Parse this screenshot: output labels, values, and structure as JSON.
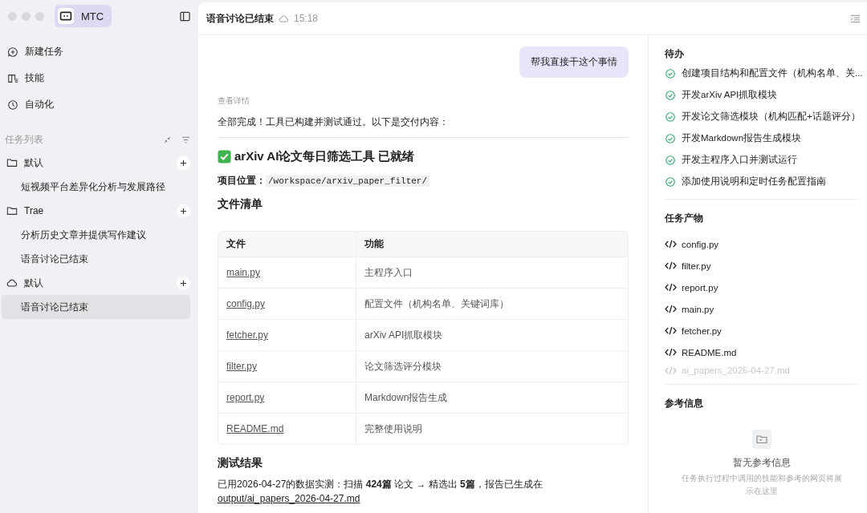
{
  "app": {
    "name": "MTC"
  },
  "nav": [
    {
      "label": "新建任务",
      "kind": "new"
    },
    {
      "label": "技能",
      "kind": "skills"
    },
    {
      "label": "自动化",
      "kind": "automation"
    }
  ],
  "task_list": {
    "title": "任务列表",
    "groups": [
      {
        "name": "默认",
        "kind": "folder",
        "items": [
          {
            "label": "短视频平台差异化分析与发展路径",
            "selected": false
          }
        ]
      },
      {
        "name": "Trae",
        "kind": "folder",
        "items": [
          {
            "label": "分析历史文章并提供写作建议",
            "selected": false
          },
          {
            "label": "语音讨论已结束",
            "selected": false
          }
        ]
      },
      {
        "name": "默认",
        "kind": "cloud",
        "items": [
          {
            "label": "语音讨论已结束",
            "selected": true
          }
        ]
      }
    ]
  },
  "header": {
    "title": "语音讨论已结束",
    "time": "15:18"
  },
  "chat": {
    "user_message": "帮我直接干这个事情",
    "details_link": "查看详情",
    "intro": "全部完成！工具已构建并测试通过。以下是交付内容：",
    "heading": "arXiv AI论文每日筛选工具 已就绪",
    "location_label": "项目位置：",
    "location_path": "/workspace/arxiv_paper_filter/",
    "files_heading": "文件清单",
    "table": {
      "columns": [
        "文件",
        "功能"
      ],
      "rows": [
        [
          "main.py",
          "主程序入口"
        ],
        [
          "config.py",
          "配置文件（机构名单、关键词库）"
        ],
        [
          "fetcher.py",
          "arXiv API抓取模块"
        ],
        [
          "filter.py",
          "论文筛选评分模块"
        ],
        [
          "report.py",
          "Markdown报告生成"
        ],
        [
          "README.md",
          "完整使用说明"
        ]
      ]
    },
    "test_heading": "测试结果",
    "test_result": "已用2026-04-27的数据实测：扫描 **424篇** 论文 → 精选出 **5篇**，报告已生成在",
    "output_link": "output/ai_papers_2026-04-27.md"
  },
  "todo": {
    "title": "待办",
    "items": [
      {
        "label": "创建项目结构和配置文件（机构名单、关...",
        "done": true
      },
      {
        "label": "开发arXiv API抓取模块",
        "done": true
      },
      {
        "label": "开发论文筛选模块（机构匹配+话题评分）",
        "done": true
      },
      {
        "label": "开发Markdown报告生成模块",
        "done": true
      },
      {
        "label": "开发主程序入口并测试运行",
        "done": true
      },
      {
        "label": "添加使用说明和定时任务配置指南",
        "done": true
      }
    ]
  },
  "artifacts": {
    "title": "任务产物",
    "items": [
      "config.py",
      "filter.py",
      "report.py",
      "main.py",
      "fetcher.py",
      "README.md",
      "ai_papers_2026-04-27.md"
    ]
  },
  "references": {
    "title": "参考信息",
    "empty_title": "暂无参考信息",
    "empty_text": "任务执行过程中调用的技能和参考的网页将展示在这里"
  }
}
